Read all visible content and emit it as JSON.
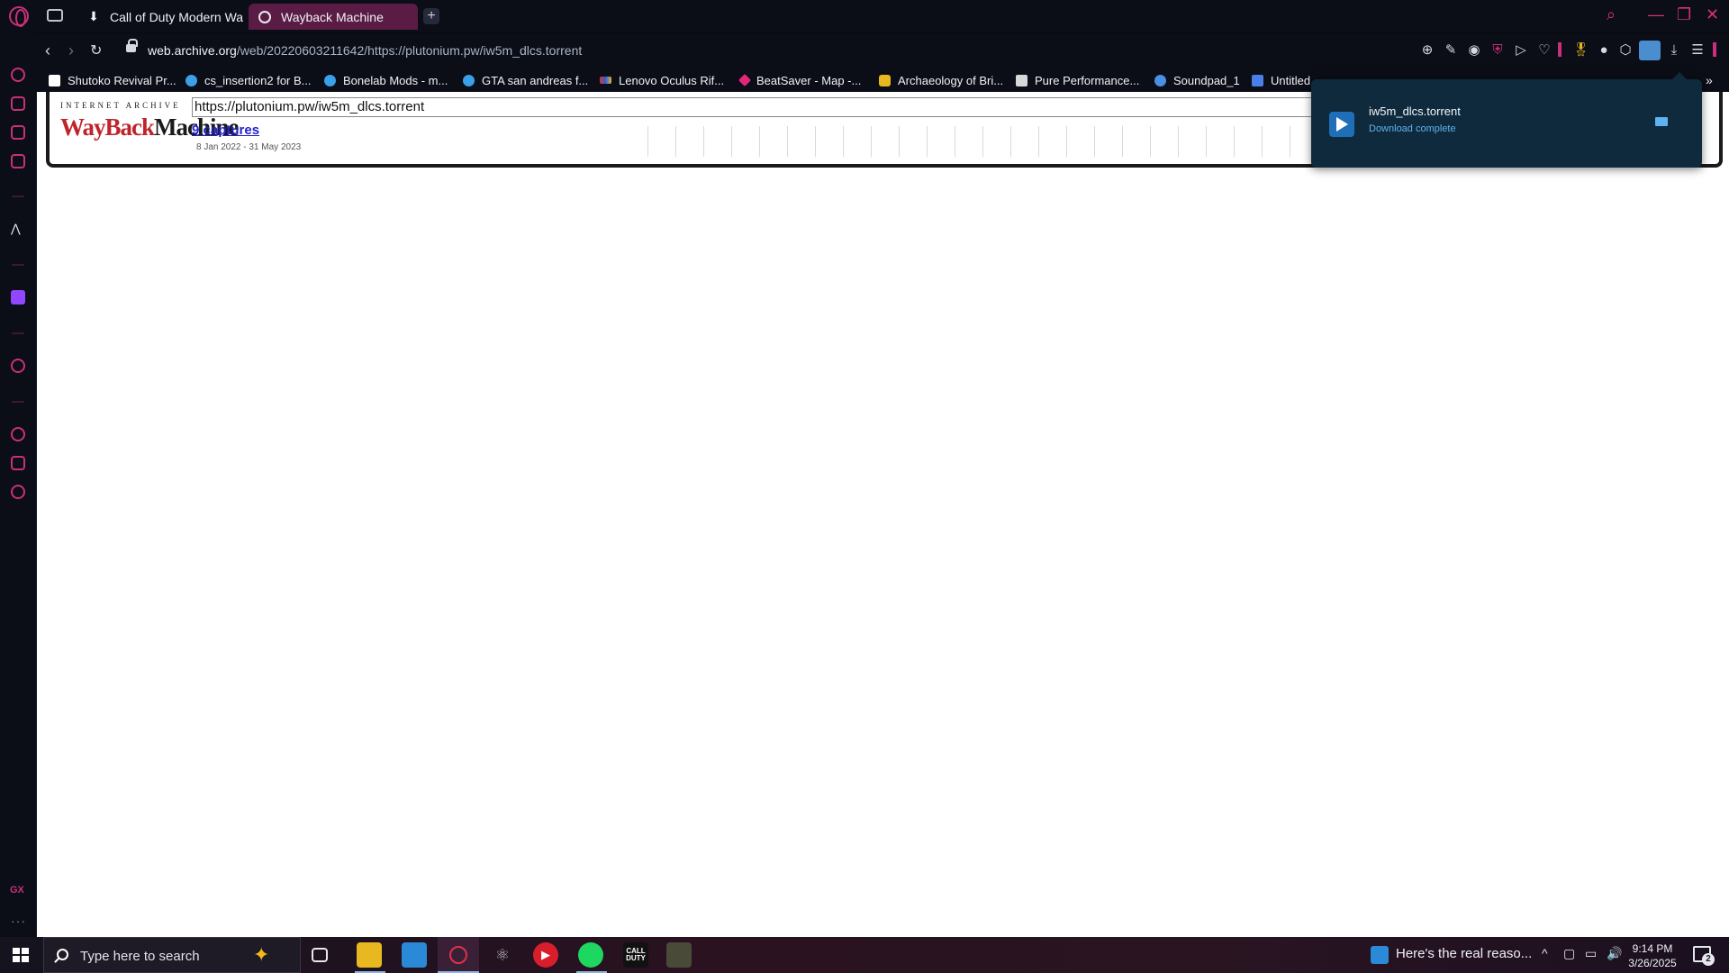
{
  "browser": {
    "tabs": [
      {
        "label": "Call of Duty Modern Warfare",
        "active": false,
        "icon": "download-arrow-icon"
      },
      {
        "label": "Wayback Machine",
        "active": true,
        "icon": "globe-icon"
      }
    ],
    "new_tab_label": "+",
    "address": {
      "host": "web.archive.org",
      "path": "/web/20220603211642/https://plutonium.pw/iw5m_dlcs.torrent"
    },
    "bookmarks": [
      {
        "label": "Shutoko Revival Pr...",
        "color": "#ffffff"
      },
      {
        "label": "cs_insertion2 for B...",
        "color": "#3aa0e8"
      },
      {
        "label": "Bonelab Mods - m...",
        "color": "#3aa0e8"
      },
      {
        "label": "GTA san andreas f...",
        "color": "#3aa0e8"
      },
      {
        "label": "Lenovo Oculus Rif...",
        "color": "#e0302a"
      },
      {
        "label": "BeatSaver - Map -...",
        "color": "#e0287a"
      },
      {
        "label": "Archaeology of Bri...",
        "color": "#e8b820"
      },
      {
        "label": "Pure Performance...",
        "color": "#d8d8d8"
      },
      {
        "label": "Soundpad_1",
        "color": "#4a90e2"
      },
      {
        "label": "Untitled",
        "color": "#4a7ee8"
      }
    ]
  },
  "wayback": {
    "ia_label": "INTERNET ARCHIVE",
    "logo_w": "WayBack",
    "logo_m": "Machine",
    "url_value": "https://plutonium.pw/iw5m_dlcs.torrent",
    "captures": "9 captures",
    "date_range": "8 Jan 2022 - 31 May 2023"
  },
  "download": {
    "file_name": "iw5m_dlcs.torrent",
    "status": "Download complete"
  },
  "taskbar": {
    "search_placeholder": "Type here to search",
    "news_text": "Here's the real reaso...",
    "time": "9:14 PM",
    "date": "3/26/2025",
    "notification_count": "2",
    "cod_label": "CALL DUTY"
  },
  "sidebar": {
    "gx_label": "GX",
    "more_label": "···"
  },
  "colors": {
    "accent": "#c8307a",
    "active_tab": "#5a1c44",
    "popup_bg": "#0f2a3c",
    "link": "#2222cc"
  }
}
